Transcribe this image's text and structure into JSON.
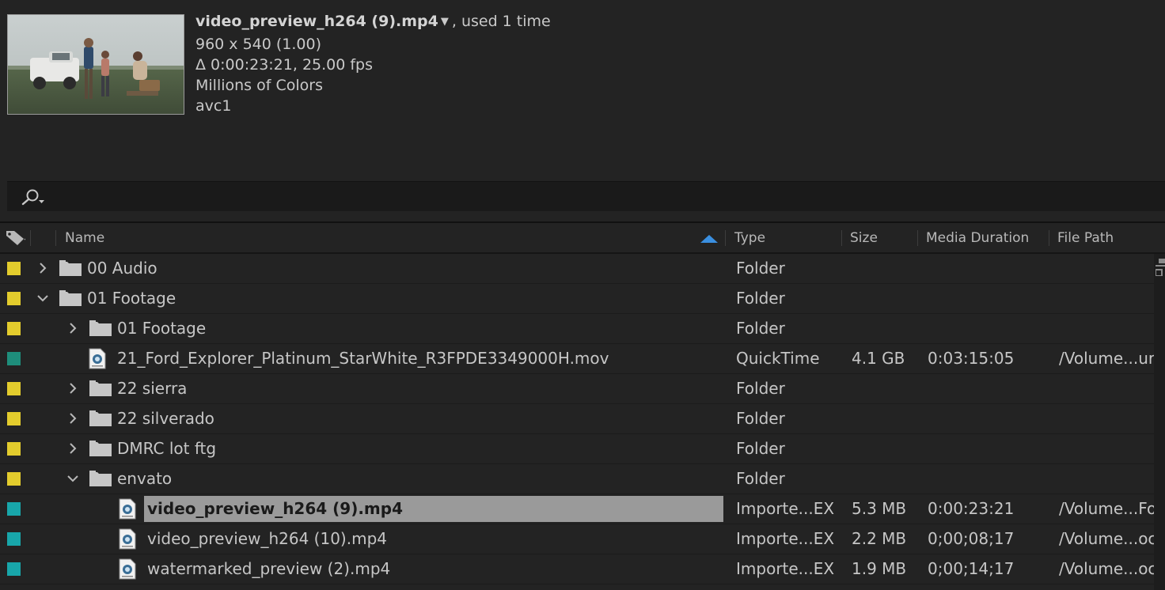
{
  "preview": {
    "clip_name": "video_preview_h264 (9).mp4",
    "usage": ", used 1 time",
    "dims": "960 x 540 (1.00)",
    "duration": "Δ 0:00:23:21, 25.00 fps",
    "colors": "Millions of Colors",
    "codec": "avc1"
  },
  "search": {
    "placeholder": "",
    "value": ""
  },
  "columns": {
    "name": "Name",
    "type": "Type",
    "size": "Size",
    "media_duration": "Media Duration",
    "file_path": "File Path",
    "sort_column": "Name",
    "sort_direction": "ascending"
  },
  "label_colors": {
    "yellow": "#e3cc2d",
    "teal": "#1e8d7b",
    "cyan": "#18a6aa",
    "selection": "#9a9a9a"
  },
  "rows": [
    {
      "name": "00 Audio",
      "type": "Folder",
      "size": "",
      "duration": "",
      "path": "",
      "label": "yellow",
      "kind": "folder",
      "depth": 0,
      "expanded": false,
      "selected": false
    },
    {
      "name": "01 Footage",
      "type": "Folder",
      "size": "",
      "duration": "",
      "path": "",
      "label": "yellow",
      "kind": "folder",
      "depth": 0,
      "expanded": true,
      "selected": false
    },
    {
      "name": "01 Footage",
      "type": "Folder",
      "size": "",
      "duration": "",
      "path": "",
      "label": "yellow",
      "kind": "folder",
      "depth": 1,
      "expanded": false,
      "selected": false
    },
    {
      "name": "21_Ford_Explorer_Platinum_StarWhite_R3FPDE3349000H.mov",
      "type": "QuickTime",
      "size": "4.1 GB",
      "duration": "0:03:15:05",
      "path": "/Volume...ur",
      "label": "teal",
      "kind": "file",
      "depth": 1,
      "expanded": false,
      "selected": false
    },
    {
      "name": "22 sierra",
      "type": "Folder",
      "size": "",
      "duration": "",
      "path": "",
      "label": "yellow",
      "kind": "folder",
      "depth": 1,
      "expanded": false,
      "selected": false
    },
    {
      "name": "22 silverado",
      "type": "Folder",
      "size": "",
      "duration": "",
      "path": "",
      "label": "yellow",
      "kind": "folder",
      "depth": 1,
      "expanded": false,
      "selected": false
    },
    {
      "name": "DMRC lot ftg",
      "type": "Folder",
      "size": "",
      "duration": "",
      "path": "",
      "label": "yellow",
      "kind": "folder",
      "depth": 1,
      "expanded": false,
      "selected": false
    },
    {
      "name": "envato",
      "type": "Folder",
      "size": "",
      "duration": "",
      "path": "",
      "label": "yellow",
      "kind": "folder",
      "depth": 1,
      "expanded": true,
      "selected": false
    },
    {
      "name": "video_preview_h264 (9).mp4",
      "type": "Importe...EX",
      "size": "5.3 MB",
      "duration": "0:00:23:21",
      "path": "/Volume...Fo",
      "label": "cyan",
      "kind": "file",
      "depth": 2,
      "expanded": false,
      "selected": true
    },
    {
      "name": "video_preview_h264 (10).mp4",
      "type": "Importe...EX",
      "size": "2.2 MB",
      "duration": "0;00;08;17",
      "path": "/Volume...oc",
      "label": "cyan",
      "kind": "file",
      "depth": 2,
      "expanded": false,
      "selected": false
    },
    {
      "name": "watermarked_preview (2).mp4",
      "type": "Importe...EX",
      "size": "1.9 MB",
      "duration": "0;00;14;17",
      "path": "/Volume...oc",
      "label": "cyan",
      "kind": "file",
      "depth": 2,
      "expanded": false,
      "selected": false
    }
  ]
}
